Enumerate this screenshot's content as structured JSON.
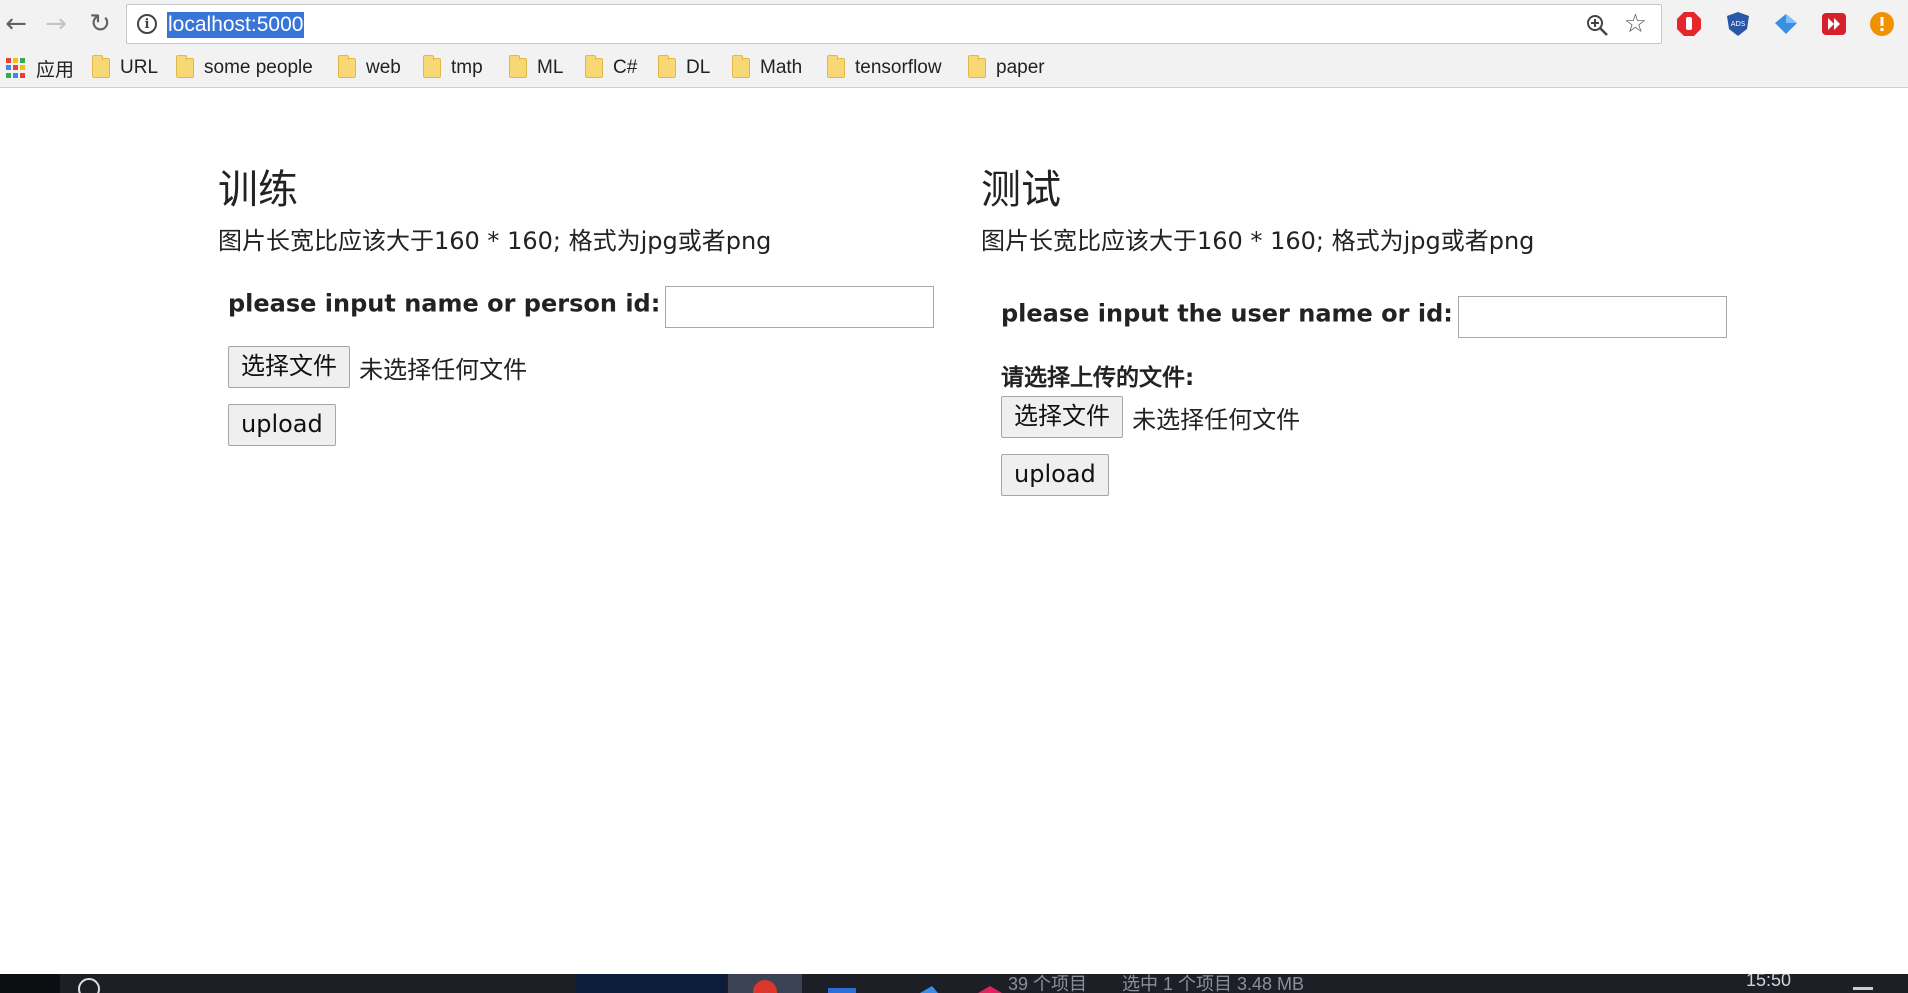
{
  "browser": {
    "url": "localhost:5000",
    "nav": {
      "back_icon": "←",
      "forward_icon": "→",
      "reload_icon": "↻"
    },
    "info_icon": "i",
    "star_icon": "☆",
    "bookmarks": [
      {
        "label": "应用",
        "icon": "apps-icon"
      },
      {
        "label": "URL",
        "icon": "folder-icon"
      },
      {
        "label": "some people",
        "icon": "folder-icon"
      },
      {
        "label": "web",
        "icon": "folder-icon"
      },
      {
        "label": "tmp",
        "icon": "folder-icon"
      },
      {
        "label": "ML",
        "icon": "folder-icon"
      },
      {
        "label": "C#",
        "icon": "folder-icon"
      },
      {
        "label": "DL",
        "icon": "folder-icon"
      },
      {
        "label": "Math",
        "icon": "folder-icon"
      },
      {
        "label": "tensorflow",
        "icon": "folder-icon"
      },
      {
        "label": "paper",
        "icon": "folder-icon"
      }
    ],
    "extensions": [
      "adblock-icon",
      "abp-shield-icon",
      "diamond-icon",
      "media-icon",
      "alert-icon"
    ]
  },
  "train": {
    "title": "训练",
    "hint": "图片长宽比应该大于160 * 160; 格式为jpg或者png",
    "name_label": "please input name or person id:",
    "name_value": "",
    "choose_file_label": "选择文件",
    "no_file_label": "未选择任何文件",
    "upload_label": "upload"
  },
  "test": {
    "title": "测试",
    "hint": "图片长宽比应该大于160 * 160; 格式为jpg或者png",
    "name_label": "please input the user name or id:",
    "name_value": "",
    "select_file_label": "请选择上传的文件:",
    "choose_file_label": "选择文件",
    "no_file_label": "未选择任何文件",
    "upload_label": "upload"
  },
  "taskbar": {
    "items_count": "39 个项目",
    "selection": "选中 1 个项目 3.48 MB",
    "time": "15:50"
  },
  "colors": {
    "url_highlight": "#3875d7",
    "folder": "#f8d775",
    "taskbar": "#1c1f26"
  }
}
